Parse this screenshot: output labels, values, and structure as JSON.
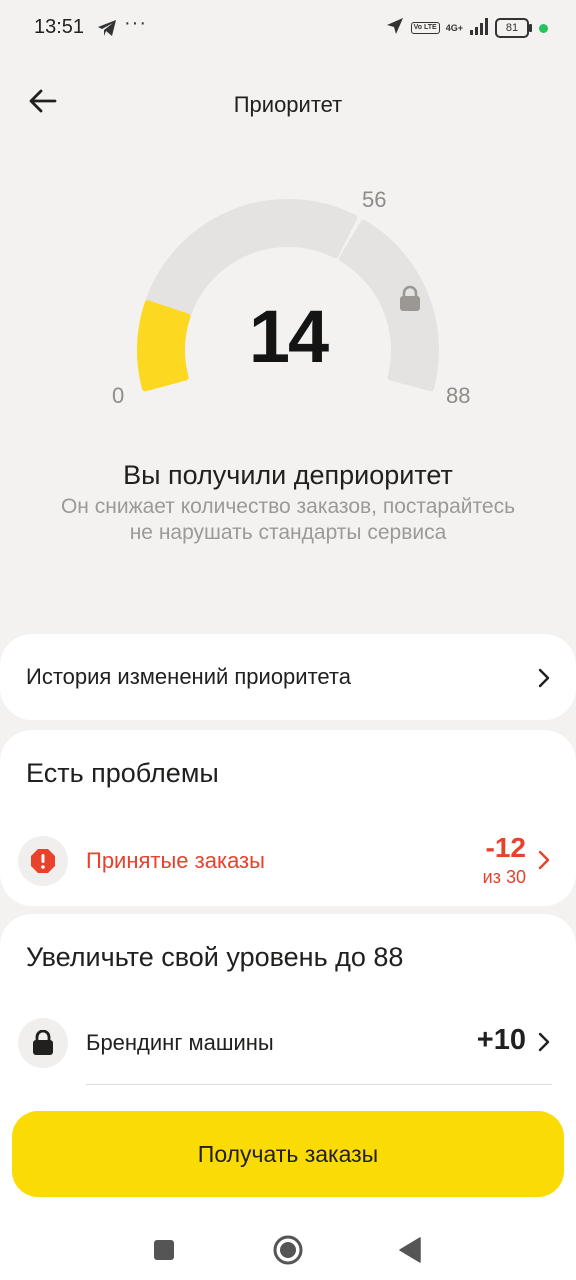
{
  "status_bar": {
    "time": "13:51",
    "dots": "···",
    "volte": "Vo LTE",
    "network": "4G+",
    "battery": "81",
    "icons": [
      "telegram-icon",
      "location-arrow-icon",
      "signal-icon",
      "battery-icon"
    ]
  },
  "header": {
    "title": "Приоритет",
    "back_icon": "arrow-left-icon"
  },
  "gauge": {
    "value": "14",
    "min_label": "0",
    "threshold_label": "56",
    "max_label": "88",
    "current": 14,
    "min": 0,
    "threshold": 56,
    "max": 88,
    "locked_icon": "lock-icon",
    "fill_color": "#fcd820",
    "track_color": "#e4e3e1"
  },
  "status": {
    "title": "Вы получили деприоритет",
    "description": "Он снижает количество заказов, постарайтесь не нарушать стандарты сервиса"
  },
  "history": {
    "label": "История изменений приоритета"
  },
  "problems": {
    "heading": "Есть проблемы",
    "items": [
      {
        "label": "Принятые заказы",
        "value": "-12",
        "sub": "из 30",
        "icon": "alert-octagon-icon",
        "color": "#e8412c"
      }
    ]
  },
  "improve": {
    "heading": "Увеличьте свой уровень до 88",
    "items": [
      {
        "label": "Брендинг машины",
        "value": "+10",
        "icon": "lock-icon"
      }
    ]
  },
  "cta": {
    "label": "Получать заказы",
    "color": "#fbdb04"
  },
  "nav": {
    "icons": [
      "square-icon",
      "circle-home-icon",
      "triangle-back-icon"
    ]
  }
}
